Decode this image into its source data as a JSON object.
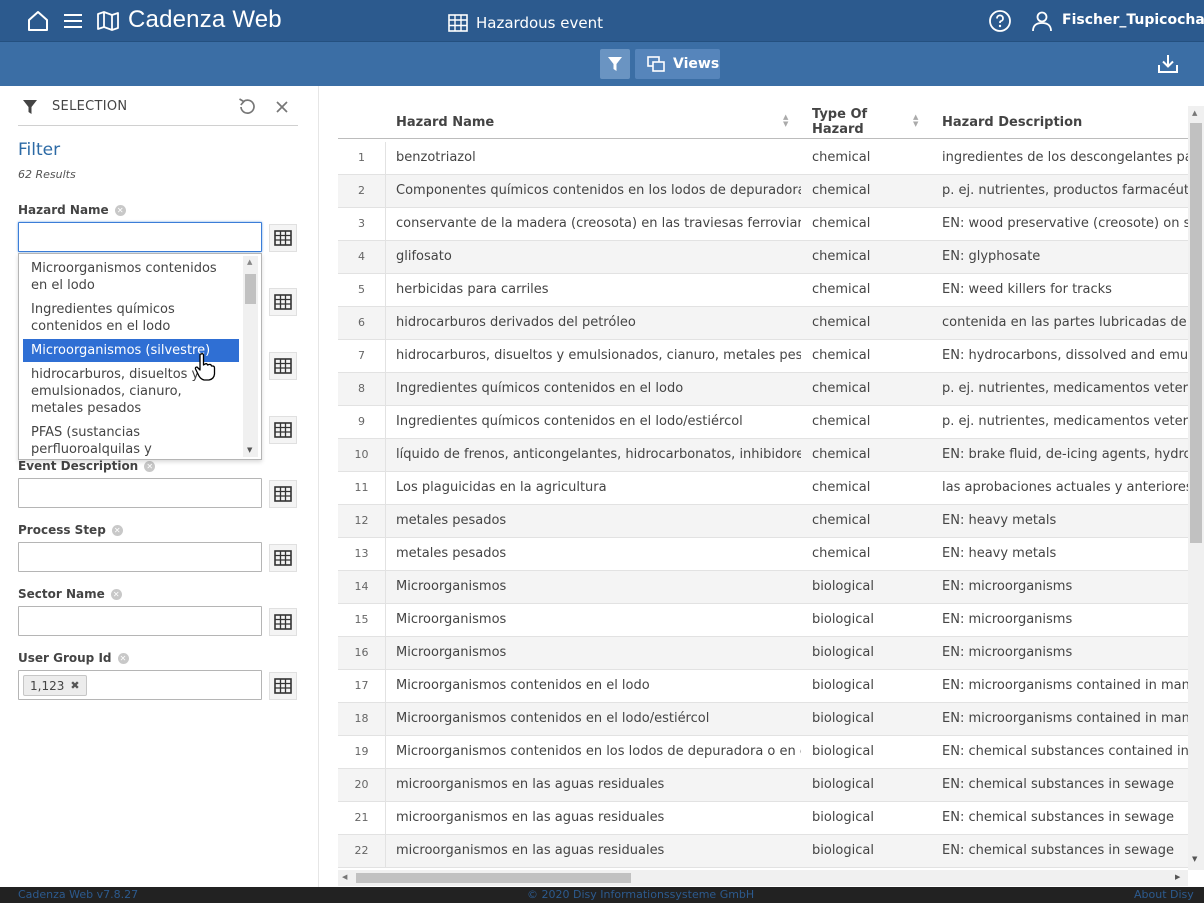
{
  "app": {
    "name": "Cadenza Web",
    "user": "Fischer_Tupicocha"
  },
  "toolbar": {
    "title": "Hazardous event",
    "views_label": "Views"
  },
  "selection": {
    "label": "SELECTION",
    "filter_title": "Filter",
    "results": "62  Results",
    "fields": [
      {
        "label": "Hazard Name",
        "value": ""
      },
      {
        "label": "Event Description",
        "value": ""
      },
      {
        "label": "Process Step",
        "value": ""
      },
      {
        "label": "Sector Name",
        "value": ""
      },
      {
        "label": "User Group Id",
        "chip": "1,123"
      }
    ],
    "dropdown_options": [
      "Microorganismos contenidos en el lodo",
      "Ingredientes químicos contenidos en el lodo",
      "Microorganismos (silvestre)",
      "hidrocarburos, disueltos y emulsionados, cianuro, metales pesados",
      "PFAS (sustancias perfluoroalquilas y polifluoradas)"
    ],
    "dropdown_selected": "Microorganismos (silvestre)"
  },
  "table": {
    "columns": [
      "Hazard Name",
      "Type Of Hazard",
      "Hazard Description"
    ],
    "rows": [
      {
        "n": "1",
        "name": "benzotriazol",
        "type": "chemical",
        "desc": "ingredientes de los descongelantes para a"
      },
      {
        "n": "2",
        "name": "Componentes químicos contenidos en los lodos de depuradora o e...",
        "type": "chemical",
        "desc": "p. ej. nutrientes, productos farmacéuticos,"
      },
      {
        "n": "3",
        "name": "conservante de la madera (creosota) en las traviesas ferroviarias",
        "type": "chemical",
        "desc": "EN: wood preservative (creosote) on sleep"
      },
      {
        "n": "4",
        "name": "glifosato",
        "type": "chemical",
        "desc": "EN: glyphosate"
      },
      {
        "n": "5",
        "name": "herbicidas para carriles",
        "type": "chemical",
        "desc": "EN: weed killers for tracks"
      },
      {
        "n": "6",
        "name": "hidrocarburos derivados del petróleo",
        "type": "chemical",
        "desc": "contenida en las partes lubricadas de los v"
      },
      {
        "n": "7",
        "name": "hidrocarburos, disueltos y emulsionados, cianuro, metales pesados",
        "type": "chemical",
        "desc": "EN: hydrocarbons, dissolved and emulsifie"
      },
      {
        "n": "8",
        "name": "Ingredientes químicos contenidos en el lodo",
        "type": "chemical",
        "desc": "p. ej. nutrientes, medicamentos veterinari"
      },
      {
        "n": "9",
        "name": "Ingredientes químicos contenidos en el lodo/estiércol",
        "type": "chemical",
        "desc": "p. ej. nutrientes, medicamentos veterinari"
      },
      {
        "n": "10",
        "name": "líquido de frenos, anticongelantes, hidrocarbonatos, inhibidores de...",
        "type": "chemical",
        "desc": "EN: brake fluid, de-icing agents, hydrocarb"
      },
      {
        "n": "11",
        "name": "Los plaguicidas en la agricultura",
        "type": "chemical",
        "desc": "las aprobaciones actuales y anteriores que"
      },
      {
        "n": "12",
        "name": "metales pesados",
        "type": "chemical",
        "desc": "EN: heavy metals"
      },
      {
        "n": "13",
        "name": "metales pesados",
        "type": "chemical",
        "desc": "EN: heavy metals"
      },
      {
        "n": "14",
        "name": "Microorganismos",
        "type": "biological",
        "desc": "EN: microorganisms"
      },
      {
        "n": "15",
        "name": "Microorganismos",
        "type": "biological",
        "desc": "EN: microorganisms"
      },
      {
        "n": "16",
        "name": "Microorganismos",
        "type": "biological",
        "desc": "EN: microorganisms"
      },
      {
        "n": "17",
        "name": "Microorganismos contenidos en el lodo",
        "type": "biological",
        "desc": "EN: microorganisms contained in manure"
      },
      {
        "n": "18",
        "name": "Microorganismos contenidos en el lodo/estiércol",
        "type": "biological",
        "desc": "EN: microorganisms contained in manure"
      },
      {
        "n": "19",
        "name": "Microorganismos contenidos en los lodos de depuradora o en el co...",
        "type": "biological",
        "desc": "EN: chemical substances contained in sluc"
      },
      {
        "n": "20",
        "name": "microorganismos en las aguas residuales",
        "type": "biological",
        "desc": "EN: chemical substances in sewage"
      },
      {
        "n": "21",
        "name": "microorganismos en las aguas residuales",
        "type": "biological",
        "desc": "EN: chemical substances in sewage"
      },
      {
        "n": "22",
        "name": "microorganismos en las aguas residuales",
        "type": "biological",
        "desc": "EN: chemical substances in sewage"
      }
    ]
  },
  "footer": {
    "version": "Cadenza Web v7.8.27",
    "copyright": "© 2020 Disy Informationssysteme GmbH",
    "about": "About Disy"
  },
  "colors": {
    "header": "#2c5a8e",
    "toolbar": "#3b6ea5",
    "link": "#2c6aa5",
    "selected": "#2f6fd4"
  },
  "icons": [
    "home-icon",
    "menu-icon",
    "map-icon",
    "help-icon",
    "user-icon",
    "table-icon",
    "filter-icon",
    "views-icon",
    "download-icon",
    "reset-icon",
    "close-icon",
    "clear-icon"
  ]
}
